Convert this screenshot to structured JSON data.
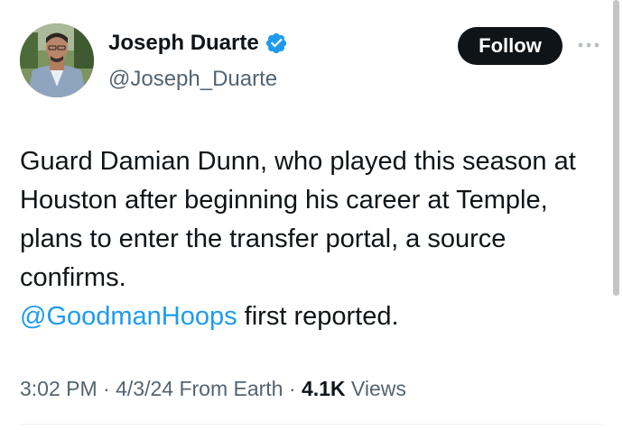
{
  "user": {
    "name": "Joseph Duarte",
    "handle": "@Joseph_Duarte",
    "verified": true,
    "verified_color": "#1d9bf0"
  },
  "actions": {
    "follow_label": "Follow",
    "more_icon": "ellipsis-icon"
  },
  "tweet": {
    "text_main": "Guard Damian Dunn, who played this season at Houston after beginning his career at Temple, plans to enter the transfer portal, a source confirms.",
    "mention": "@GoodmanHoops",
    "text_after_mention": " first reported."
  },
  "meta": {
    "time": "3:02 PM",
    "date": "4/3/24",
    "location": "From Earth",
    "views_count": "4.1K",
    "views_label": "Views",
    "separator": "·"
  },
  "colors": {
    "accent": "#1d9bf0",
    "text": "#0f1419",
    "secondary": "#536471"
  }
}
